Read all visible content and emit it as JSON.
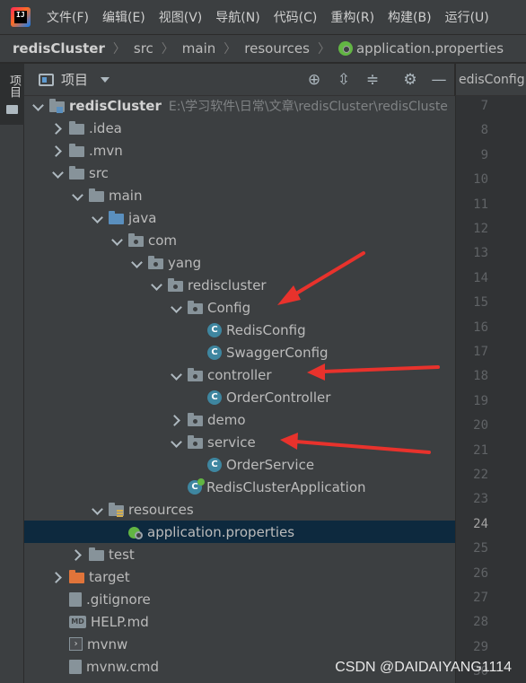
{
  "menubar": {
    "items": [
      "文件(F)",
      "编辑(E)",
      "视图(V)",
      "导航(N)",
      "代码(C)",
      "重构(R)",
      "构建(B)",
      "运行(U)"
    ]
  },
  "breadcrumb": {
    "items": [
      "redisCluster",
      "src",
      "main",
      "resources",
      "application.properties"
    ]
  },
  "tool_stripe": {
    "project_tab": "项目"
  },
  "project_panel": {
    "title": "项目",
    "tree": [
      {
        "label": "redisCluster",
        "hint": "E:\\学习软件\\日常\\文章\\redisCluster\\redisCluste",
        "depth": 0,
        "state": "open",
        "icon": "module-folder-icon",
        "strong": true
      },
      {
        "label": ".idea",
        "depth": 1,
        "state": "closed",
        "icon": "folder-icon"
      },
      {
        "label": ".mvn",
        "depth": 1,
        "state": "closed",
        "icon": "folder-icon"
      },
      {
        "label": "src",
        "depth": 1,
        "state": "open",
        "icon": "folder-icon"
      },
      {
        "label": "main",
        "depth": 2,
        "state": "open",
        "icon": "folder-icon"
      },
      {
        "label": "java",
        "depth": 3,
        "state": "open",
        "icon": "source-folder-icon"
      },
      {
        "label": "com",
        "depth": 4,
        "state": "open",
        "icon": "package-icon"
      },
      {
        "label": "yang",
        "depth": 5,
        "state": "open",
        "icon": "package-icon"
      },
      {
        "label": "rediscluster",
        "depth": 6,
        "state": "open",
        "icon": "package-icon"
      },
      {
        "label": "Config",
        "depth": 7,
        "state": "open",
        "icon": "package-icon"
      },
      {
        "label": "RedisConfig",
        "depth": 8,
        "state": "leaf",
        "icon": "class-icon"
      },
      {
        "label": "SwaggerConfig",
        "depth": 8,
        "state": "leaf",
        "icon": "class-icon"
      },
      {
        "label": "controller",
        "depth": 7,
        "state": "open",
        "icon": "package-icon"
      },
      {
        "label": "OrderController",
        "depth": 8,
        "state": "leaf",
        "icon": "class-icon"
      },
      {
        "label": "demo",
        "depth": 7,
        "state": "closed",
        "icon": "package-icon"
      },
      {
        "label": "service",
        "depth": 7,
        "state": "open",
        "icon": "package-icon"
      },
      {
        "label": "OrderService",
        "depth": 8,
        "state": "leaf",
        "icon": "class-icon"
      },
      {
        "label": "RedisClusterApplication",
        "depth": 7,
        "state": "leaf",
        "icon": "spring-boot-class-icon"
      },
      {
        "label": "resources",
        "depth": 3,
        "state": "open",
        "icon": "resources-folder-icon"
      },
      {
        "label": "application.properties",
        "depth": 4,
        "state": "leaf",
        "icon": "spring-properties-icon",
        "selected": true
      },
      {
        "label": "test",
        "depth": 2,
        "state": "closed",
        "icon": "folder-icon"
      },
      {
        "label": "target",
        "depth": 1,
        "state": "closed",
        "icon": "excluded-folder-icon"
      },
      {
        "label": ".gitignore",
        "depth": 1,
        "state": "leaf",
        "icon": "gitignore-file-icon"
      },
      {
        "label": "HELP.md",
        "depth": 1,
        "state": "leaf",
        "icon": "markdown-file-icon"
      },
      {
        "label": "mvnw",
        "depth": 1,
        "state": "leaf",
        "icon": "shell-script-icon"
      },
      {
        "label": "mvnw.cmd",
        "depth": 1,
        "state": "leaf",
        "icon": "cmd-file-icon"
      }
    ]
  },
  "editor": {
    "tab_label": "edisConfig",
    "line_numbers": [
      "7",
      "8",
      "9",
      "10",
      "11",
      "12",
      "13",
      "14",
      "15",
      "16",
      "17",
      "18",
      "19",
      "20",
      "21",
      "22",
      "23",
      "24",
      "25",
      "26",
      "27",
      "28",
      "29",
      "30"
    ],
    "current_line": "24"
  },
  "watermark": "CSDN @DAIDAIYANG1114",
  "colors": {
    "selection": "#0d293e",
    "arrow": "#e8322c",
    "spring_green": "#62b543",
    "class_blue": "#3e86a0"
  }
}
